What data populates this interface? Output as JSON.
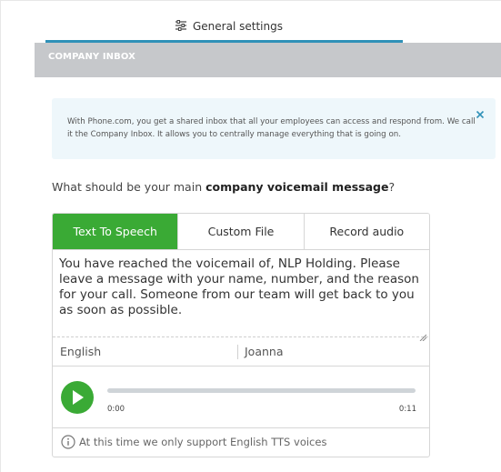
{
  "header": {
    "tab_icon": "sliders-icon",
    "tab_label": "General settings",
    "accent_color": "#2f91b8"
  },
  "section": {
    "title": "COMPANY INBOX"
  },
  "info": {
    "text": "With Phone.com, you get a shared inbox that all your employees can access and respond from. We call it the Company Inbox. It allows you to centrally manage everything that is going on.",
    "close_icon": "close-icon"
  },
  "question": {
    "prefix": "What should be your main ",
    "bold": "company voicemail message",
    "suffix": "?"
  },
  "source_tabs": [
    {
      "label": "Text To Speech",
      "active": true
    },
    {
      "label": "Custom File",
      "active": false
    },
    {
      "label": "Record audio",
      "active": false
    }
  ],
  "message": {
    "value": "You have reached the voicemail of, NLP Holding. Please leave a message with your name, number, and the reason for your call. Someone from our team will get back to you as soon as possible."
  },
  "voice": {
    "language": "English",
    "voice_name": "Joanna"
  },
  "player": {
    "play_icon": "play-icon",
    "current_time": "0:00",
    "duration": "0:11",
    "progress": 0,
    "accent_color": "#3aaa35"
  },
  "footer": {
    "icon": "info-icon",
    "text": "At this time we only support English TTS voices"
  }
}
